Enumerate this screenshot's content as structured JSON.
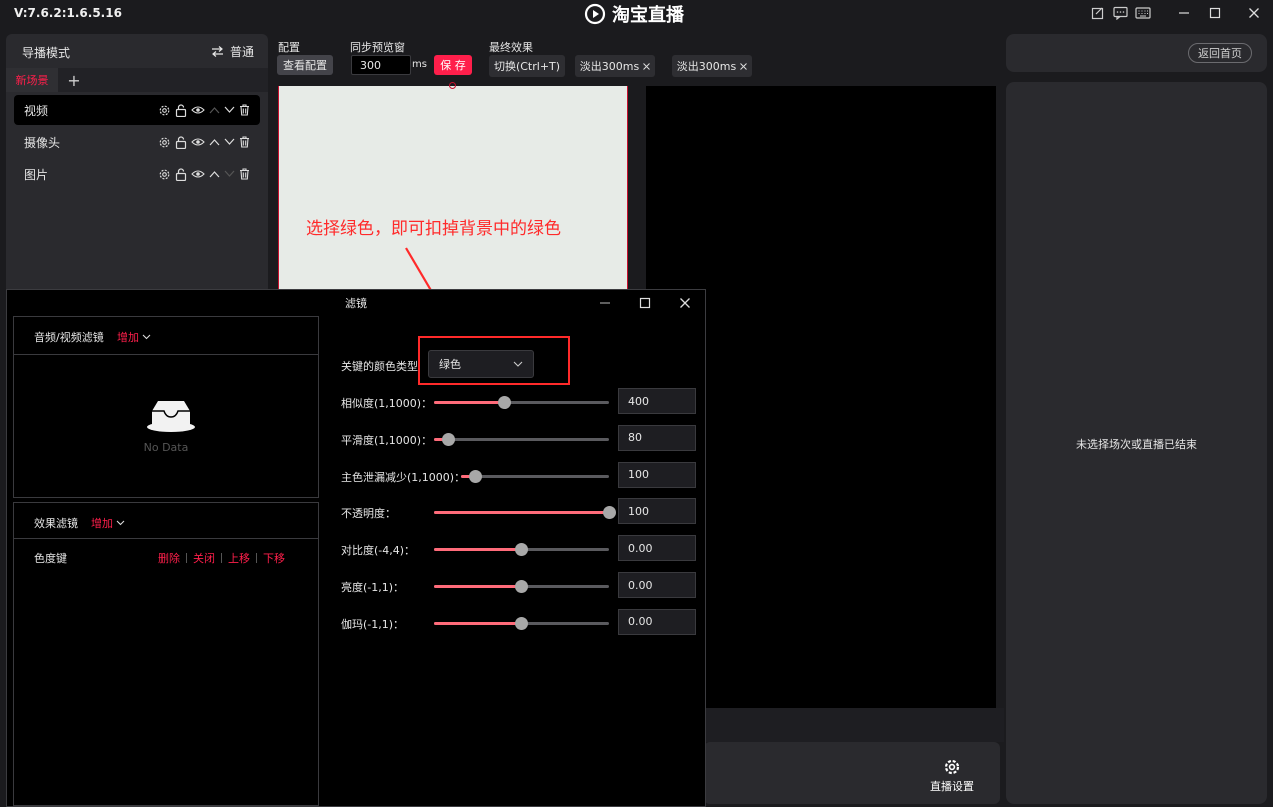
{
  "app": {
    "version": "V:7.6.2:1.6.5.16",
    "title": "淘宝直播"
  },
  "left_panel": {
    "nav_mode_label": "导播模式",
    "mode_label": "普通",
    "scene_tab": "新场景",
    "add_scene": "+",
    "sources": [
      {
        "name": "视频"
      },
      {
        "name": "摄像头"
      },
      {
        "name": "图片"
      }
    ]
  },
  "toolbar": {
    "config_label": "配置",
    "view_config": "查看配置",
    "sync_label": "同步预览窗",
    "sync_value": "300",
    "sync_unit": "ms",
    "save": "保 存",
    "final_label": "最终效果",
    "switch": "切换(Ctrl+T)",
    "fade1": "淡出300ms",
    "fade2": "淡出300ms"
  },
  "annotation": "选择绿色，即可扣掉背景中的绿色",
  "bottom": {
    "live_settings": "直播设置"
  },
  "right_panel": {
    "home": "返回首页",
    "message": "未选择场次或直播已结束"
  },
  "filter_dialog": {
    "title": "滤镜",
    "av_filters_label": "音频/视频滤镜",
    "add": "增加",
    "no_data": "No Data",
    "effect_filters_label": "效果滤镜",
    "effect_add": "增加",
    "effect_row": {
      "name": "色度键",
      "delete": "删除",
      "close": "关闭",
      "up": "上移",
      "down": "下移"
    },
    "key_color_label": "关键的颜色类型",
    "key_color_value": "绿色",
    "params": [
      {
        "label": "相似度(1,1000)：",
        "value": "400",
        "fill": 0.4
      },
      {
        "label": "平滑度(1,1000)：",
        "value": "80",
        "fill": 0.08
      },
      {
        "label": "主色泄漏减少(1,1000)：",
        "value": "100",
        "fill": 0.1
      },
      {
        "label": "不透明度：",
        "value": "100",
        "fill": 1.0
      },
      {
        "label": "对比度(-4,4)：",
        "value": "0.00",
        "fill": 0.5
      },
      {
        "label": "亮度(-1,1)：",
        "value": "0.00",
        "fill": 0.5
      },
      {
        "label": "伽玛(-1,1)：",
        "value": "0.00",
        "fill": 0.5
      }
    ]
  },
  "colors": {
    "accent": "#ff1f4b",
    "annotation": "#ff2a2a"
  }
}
